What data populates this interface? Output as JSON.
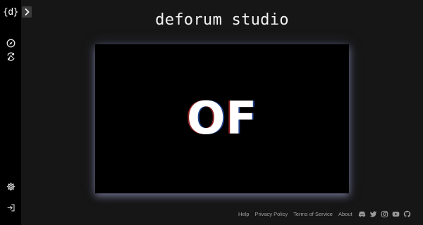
{
  "brand": {
    "logo_text": "{d}",
    "title": "deforum studio"
  },
  "sidebar": {
    "icons": [
      "compass-icon",
      "refresh-icon",
      "settings-icon",
      "login-icon"
    ]
  },
  "stage": {
    "text": "OF"
  },
  "footer": {
    "links": [
      "Help",
      "Privacy Policy",
      "Terms of Service",
      "About"
    ],
    "social": [
      "discord-icon",
      "twitter-icon",
      "instagram-icon",
      "youtube-icon",
      "github-icon"
    ]
  },
  "colors": {
    "background": "#161616",
    "sidebar": "#000000",
    "stage": "#000000",
    "text": "#f2f2f2",
    "muted": "#a0a0a0"
  }
}
